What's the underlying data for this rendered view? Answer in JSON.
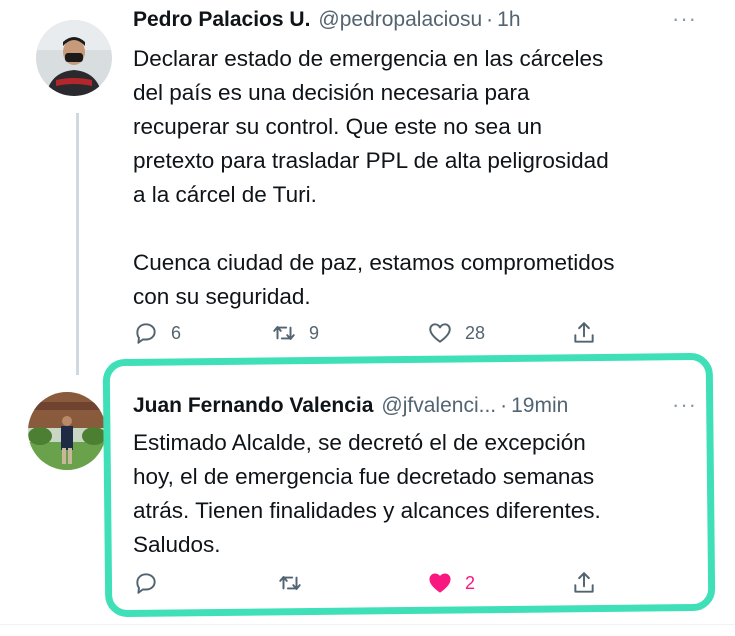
{
  "tweet1": {
    "display_name": "Pedro Palacios U.",
    "handle": "@pedropalaciosu",
    "separator": "·",
    "time": "1h",
    "more": "···",
    "text_lines": [
      "Declarar estado de emergencia en las cárceles",
      "del país es una decisión necesaria para",
      "recuperar su control. Que este no sea un",
      "pretexto para trasladar PPL de alta peligrosidad",
      "a la cárcel de Turi.",
      "",
      "Cuenca ciudad de paz, estamos  comprometidos",
      "con su seguridad."
    ],
    "reply_count": "6",
    "retweet_count": "9",
    "like_count": "28"
  },
  "tweet2": {
    "display_name": "Juan Fernando Valencia",
    "handle": "@jfvalenci...",
    "separator": "·",
    "time": "19min",
    "more": "···",
    "text_lines": [
      "Estimado Alcalde, se decretó el de excepción",
      "hoy, el de emergencia fue decretado semanas",
      "atrás. Tienen finalidades y alcances diferentes.",
      "Saludos."
    ],
    "like_count": "2",
    "liked": true
  },
  "colors": {
    "text": "#0f1419",
    "secondary": "#536471",
    "like_active": "#f91880",
    "highlight": "#3fe0b8",
    "thread_line": "#cfd9de"
  },
  "icons": {
    "reply": "reply-icon",
    "retweet": "retweet-icon",
    "like": "heart-icon",
    "share": "share-icon"
  }
}
